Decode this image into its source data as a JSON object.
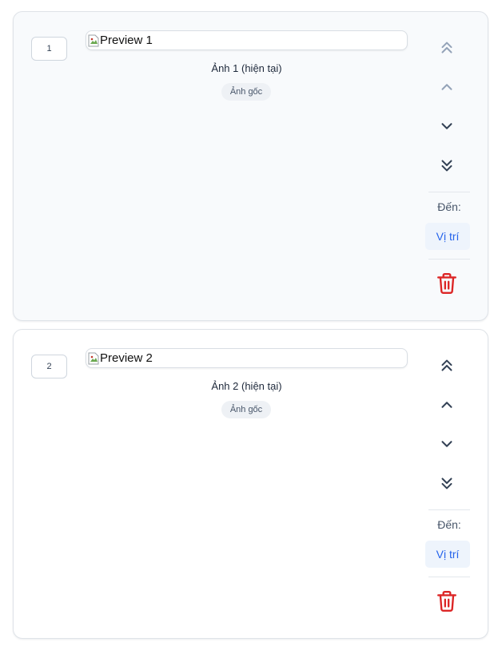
{
  "colors": {
    "icon_enabled": "#334155",
    "icon_disabled": "#94a3b8",
    "delete": "#dc2626",
    "position_button_text": "#2563eb",
    "position_button_bg": "#eef4fc"
  },
  "items": [
    {
      "index": "1",
      "preview_alt": "Preview 1",
      "caption": "Ảnh 1 (hiện tại)",
      "tag": "Ảnh gốc",
      "controls": {
        "move_top": {
          "icon": "chevrons-up-icon",
          "enabled": false
        },
        "move_up": {
          "icon": "chevron-up-icon",
          "enabled": false
        },
        "move_down": {
          "icon": "chevron-down-icon",
          "enabled": true
        },
        "move_bottom": {
          "icon": "chevrons-down-icon",
          "enabled": true
        }
      },
      "goto_label": "Đến:",
      "position_button": "Vị trí",
      "delete_icon": "trash-icon"
    },
    {
      "index": "2",
      "preview_alt": "Preview 2",
      "caption": "Ảnh 2 (hiện tại)",
      "tag": "Ảnh gốc",
      "controls": {
        "move_top": {
          "icon": "chevrons-up-icon",
          "enabled": true
        },
        "move_up": {
          "icon": "chevron-up-icon",
          "enabled": true
        },
        "move_down": {
          "icon": "chevron-down-icon",
          "enabled": true
        },
        "move_bottom": {
          "icon": "chevrons-down-icon",
          "enabled": true
        }
      },
      "goto_label": "Đến:",
      "position_button": "Vị trí",
      "delete_icon": "trash-icon"
    }
  ]
}
